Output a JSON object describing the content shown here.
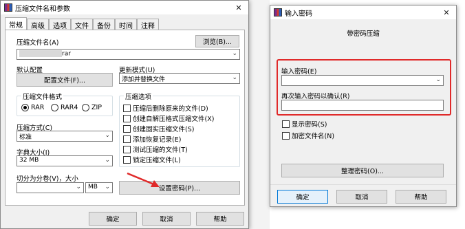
{
  "main_dialog": {
    "title": "压缩文件名和参数",
    "tabs": [
      "常规",
      "高级",
      "选项",
      "文件",
      "备份",
      "时间",
      "注释"
    ],
    "archive_name_label": "压缩文件名(A)",
    "archive_name_value": "rar",
    "browse_button": "浏览(B)...",
    "default_profile_label": "默认配置",
    "profiles_button": "配置文件(F)...",
    "update_mode_label": "更新模式(U)",
    "update_mode_value": "添加并替换文件",
    "format_group_title": "压缩文件格式",
    "formats": [
      "RAR",
      "RAR4",
      "ZIP"
    ],
    "options_group_title": "压缩选项",
    "options": [
      "压缩后删除原来的文件(D)",
      "创建自解压格式压缩文件(X)",
      "创建固实压缩文件(S)",
      "添加恢复记录(E)",
      "测试压缩的文件(T)",
      "锁定压缩文件(L)"
    ],
    "method_label": "压缩方式(C)",
    "method_value": "标准",
    "dict_label": "字典大小(I)",
    "dict_value": "32 MB",
    "split_label": "切分为分卷(V)，大小",
    "split_unit": "MB",
    "set_password_button": "设置密码(P)...",
    "ok_button": "确定",
    "cancel_button": "取消",
    "help_button": "帮助"
  },
  "password_dialog": {
    "title": "输入密码",
    "subtitle": "带密码压缩",
    "enter_label": "输入密码(E)",
    "reenter_label": "再次输入密码以确认(R)",
    "show_password": "显示密码(S)",
    "encrypt_names": "加密文件名(N)",
    "organize_button": "整理密码(O)...",
    "ok_button": "确定",
    "cancel_button": "取消",
    "help_button": "帮助"
  },
  "colors": {
    "highlight": "#e02a2a",
    "dialog_bg": "#f0f0f0"
  }
}
